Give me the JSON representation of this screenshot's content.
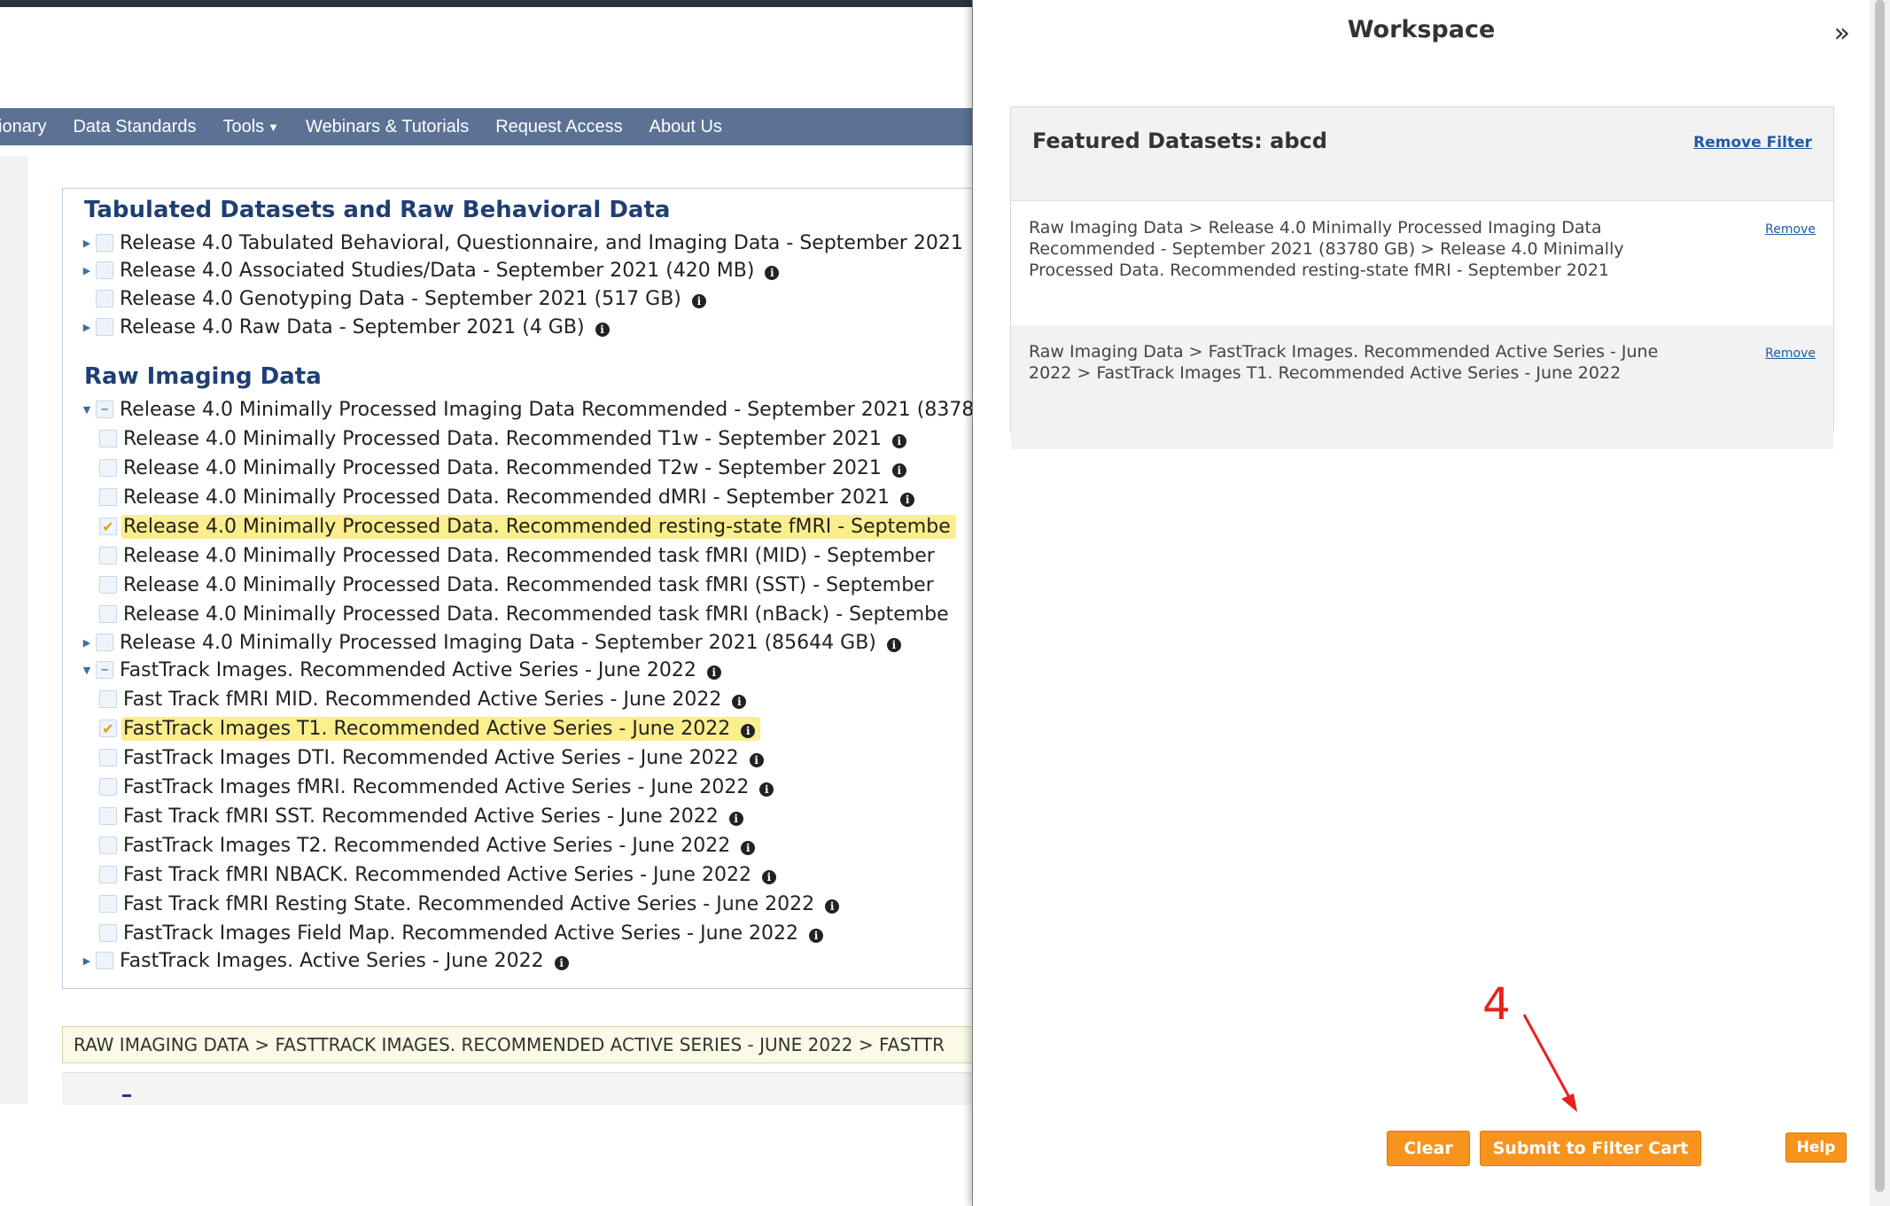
{
  "nav": {
    "items": [
      "ionary",
      "Data Standards",
      "Tools",
      "Webinars & Tutorials",
      "Request Access",
      "About Us"
    ]
  },
  "sections": {
    "tabulated": "Tabulated Datasets and Raw Behavioral Data",
    "raw_imaging": "Raw Imaging Data"
  },
  "tree": [
    {
      "label": "Release 4.0 Tabulated Behavioral, Questionnaire, and Imaging Data - September 2021",
      "level": 0,
      "expander": "collapsed",
      "check": "none",
      "info": false,
      "highlight": false
    },
    {
      "label": "Release 4.0 Associated Studies/Data - September 2021 (420 MB)",
      "level": 0,
      "expander": "collapsed",
      "check": "none",
      "info": true,
      "highlight": false
    },
    {
      "label": "Release 4.0 Genotyping Data - September 2021 (517 GB)",
      "level": 0,
      "expander": "none",
      "check": "none",
      "info": true,
      "highlight": false
    },
    {
      "label": "Release 4.0 Raw Data - September 2021 (4 GB)",
      "level": 0,
      "expander": "collapsed",
      "check": "none",
      "info": true,
      "highlight": false
    },
    {
      "label": "Release 4.0 Minimally Processed Imaging Data Recommended - September 2021 (8378",
      "level": 0,
      "expander": "expanded",
      "check": "partial",
      "info": false,
      "highlight": false
    },
    {
      "label": "Release 4.0 Minimally Processed Data. Recommended T1w - September 2021",
      "level": 1,
      "expander": "none",
      "check": "none",
      "info": true,
      "highlight": false
    },
    {
      "label": "Release 4.0 Minimally Processed Data. Recommended T2w - September 2021",
      "level": 1,
      "expander": "none",
      "check": "none",
      "info": true,
      "highlight": false
    },
    {
      "label": "Release 4.0 Minimally Processed Data. Recommended dMRI - September 2021",
      "level": 1,
      "expander": "none",
      "check": "none",
      "info": true,
      "highlight": false
    },
    {
      "label": "Release 4.0 Minimally Processed Data. Recommended resting-state fMRI - Septembe",
      "level": 1,
      "expander": "none",
      "check": "checked",
      "info": false,
      "highlight": true
    },
    {
      "label": "Release 4.0 Minimally Processed Data. Recommended task fMRI (MID) - September",
      "level": 1,
      "expander": "none",
      "check": "none",
      "info": false,
      "highlight": false
    },
    {
      "label": "Release 4.0 Minimally Processed Data. Recommended task fMRI (SST) - September",
      "level": 1,
      "expander": "none",
      "check": "none",
      "info": false,
      "highlight": false
    },
    {
      "label": "Release 4.0 Minimally Processed Data. Recommended task fMRI (nBack) - Septembe",
      "level": 1,
      "expander": "none",
      "check": "none",
      "info": false,
      "highlight": false
    },
    {
      "label": "Release 4.0 Minimally Processed Imaging Data - September 2021 (85644 GB)",
      "level": 0,
      "expander": "collapsed",
      "check": "none",
      "info": true,
      "highlight": false
    },
    {
      "label": "FastTrack Images. Recommended Active Series - June 2022",
      "level": 0,
      "expander": "expanded",
      "check": "partial",
      "info": true,
      "highlight": false
    },
    {
      "label": "Fast Track fMRI MID. Recommended Active Series - June 2022",
      "level": 1,
      "expander": "none",
      "check": "none",
      "info": true,
      "highlight": false
    },
    {
      "label": "FastTrack Images T1. Recommended Active Series - June 2022",
      "level": 1,
      "expander": "none",
      "check": "checked",
      "info": true,
      "highlight": true
    },
    {
      "label": "FastTrack Images DTI. Recommended Active Series - June 2022",
      "level": 1,
      "expander": "none",
      "check": "none",
      "info": true,
      "highlight": false
    },
    {
      "label": "FastTrack Images fMRI. Recommended Active Series - June 2022",
      "level": 1,
      "expander": "none",
      "check": "none",
      "info": true,
      "highlight": false
    },
    {
      "label": "Fast Track fMRI SST. Recommended Active Series - June 2022",
      "level": 1,
      "expander": "none",
      "check": "none",
      "info": true,
      "highlight": false
    },
    {
      "label": "FastTrack Images T2. Recommended Active Series - June 2022",
      "level": 1,
      "expander": "none",
      "check": "none",
      "info": true,
      "highlight": false
    },
    {
      "label": "Fast Track fMRI NBACK. Recommended Active Series - June 2022",
      "level": 1,
      "expander": "none",
      "check": "none",
      "info": true,
      "highlight": false
    },
    {
      "label": "Fast Track fMRI Resting State. Recommended Active Series - June 2022",
      "level": 1,
      "expander": "none",
      "check": "none",
      "info": true,
      "highlight": false
    },
    {
      "label": "FastTrack Images Field Map. Recommended Active Series - June 2022",
      "level": 1,
      "expander": "none",
      "check": "none",
      "info": true,
      "highlight": false
    },
    {
      "label": "FastTrack Images. Active Series - June 2022",
      "level": 0,
      "expander": "collapsed",
      "check": "none",
      "info": true,
      "highlight": false
    }
  ],
  "breadcrumb": "RAW IMAGING DATA > FASTTRACK IMAGES. RECOMMENDED ACTIVE SERIES - JUNE 2022 > FASTTR",
  "workspace": {
    "title": "Workspace",
    "featured_title": "Featured Datasets: abcd",
    "remove_filter": "Remove Filter",
    "items": [
      {
        "text": "Raw Imaging Data > Release 4.0 Minimally Processed Imaging Data Recommended - September 2021 (83780 GB) > Release 4.0 Minimally Processed Data. Recommended resting-state fMRI - September 2021",
        "remove": "Remove"
      },
      {
        "text": "Raw Imaging Data > FastTrack Images. Recommended Active Series - June 2022 > FastTrack Images T1. Recommended Active Series - June 2022",
        "remove": "Remove"
      }
    ],
    "buttons": {
      "clear": "Clear",
      "submit": "Submit to Filter Cart",
      "help": "Help"
    }
  },
  "annotation": {
    "step": "4",
    "color": "#e8211d"
  },
  "colors": {
    "nav_bg": "#5b7294",
    "section_title": "#1f3f73",
    "highlight": "#fbee8c",
    "button": "#f7941d",
    "link": "#1f5aa6"
  },
  "icons": {
    "collapse": "double-chevron-right-icon",
    "info": "info-icon",
    "dropdown": "caret-down-icon"
  }
}
